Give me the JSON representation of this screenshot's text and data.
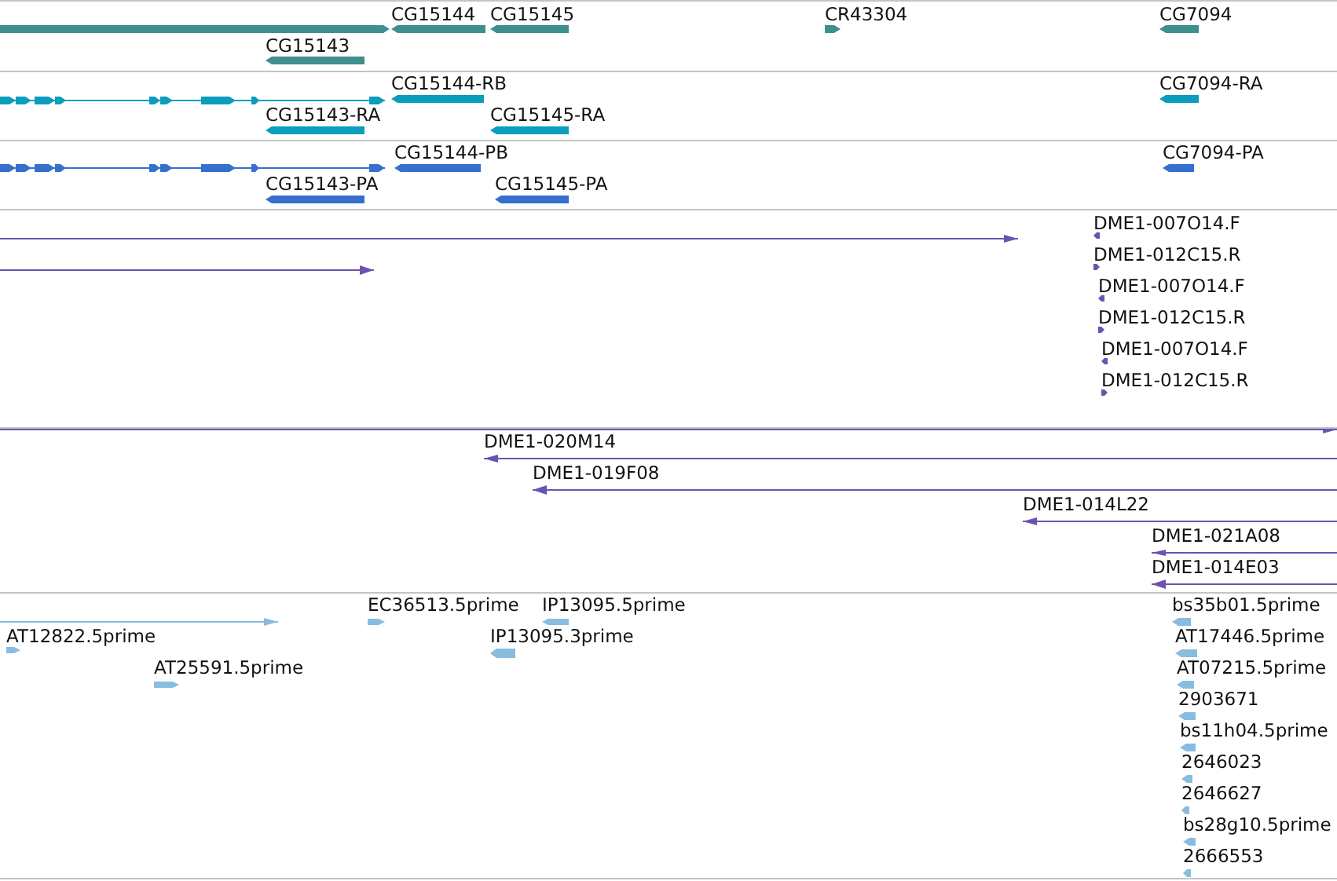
{
  "tracks": [
    {
      "color": "#3f8f8f",
      "features": [
        {
          "kind": "bar",
          "forward": true
        },
        {
          "kind": "bar",
          "forward": false,
          "label": "CG15144"
        },
        {
          "kind": "bar",
          "forward": false,
          "label": "CG15145"
        },
        {
          "kind": "bar",
          "forward": false,
          "label": "CG15143"
        },
        {
          "kind": "bar",
          "forward": true,
          "label": "CR43304"
        },
        {
          "kind": "bar",
          "forward": false,
          "label": "CG7094"
        }
      ]
    },
    {
      "color": "#0a9dbd",
      "features": [
        {
          "kind": "transcript",
          "forward": true
        },
        {
          "kind": "bar",
          "forward": false,
          "label": "CG15144-RB"
        },
        {
          "kind": "bar",
          "forward": false,
          "label": "CG15143-RA"
        },
        {
          "kind": "bar",
          "forward": false,
          "label": "CG15145-RA"
        },
        {
          "kind": "bar",
          "forward": false,
          "label": "CG7094-RA"
        }
      ]
    },
    {
      "color": "#3570cc",
      "features": [
        {
          "kind": "transcript",
          "forward": true
        },
        {
          "kind": "bar",
          "forward": false,
          "label": "CG15144-PB"
        },
        {
          "kind": "bar",
          "forward": false,
          "label": "CG15143-PA"
        },
        {
          "kind": "bar",
          "forward": false,
          "label": "CG15145-PA"
        },
        {
          "kind": "bar",
          "forward": false,
          "label": "CG7094-PA"
        }
      ]
    },
    {
      "color": "#6c52b0",
      "features": [
        {
          "kind": "line",
          "forward": true
        },
        {
          "kind": "line",
          "forward": true
        },
        {
          "kind": "marker",
          "forward": false,
          "label": "DME1-007O14.F"
        },
        {
          "kind": "marker",
          "forward": true,
          "label": "DME1-012C15.R"
        },
        {
          "kind": "marker",
          "forward": false,
          "label": "DME1-007O14.F"
        },
        {
          "kind": "marker",
          "forward": true,
          "label": "DME1-012C15.R"
        },
        {
          "kind": "marker",
          "forward": false,
          "label": "DME1-007O14.F"
        },
        {
          "kind": "marker",
          "forward": true,
          "label": "DME1-012C15.R"
        }
      ]
    },
    {
      "color": "#6c52b0",
      "features": [
        {
          "kind": "line",
          "forward": true
        },
        {
          "kind": "line",
          "forward": false,
          "label": "DME1-020M14"
        },
        {
          "kind": "line",
          "forward": false,
          "label": "DME1-019F08"
        },
        {
          "kind": "line",
          "forward": false,
          "label": "DME1-014L22"
        },
        {
          "kind": "line",
          "forward": false,
          "label": "DME1-021A08"
        },
        {
          "kind": "line",
          "forward": false,
          "label": "DME1-014E03"
        }
      ]
    },
    {
      "color": "#88bde0",
      "features": [
        {
          "kind": "line",
          "forward": true
        },
        {
          "kind": "marker",
          "forward": true,
          "label": "AT12822.5prime"
        },
        {
          "kind": "marker",
          "forward": true,
          "label": "EC36513.5prime"
        },
        {
          "kind": "marker",
          "forward": false,
          "label": "IP13095.5prime"
        },
        {
          "kind": "bar",
          "forward": false,
          "label": "IP13095.3prime"
        },
        {
          "kind": "marker",
          "forward": true,
          "label": "AT25591.5prime"
        },
        {
          "kind": "marker",
          "forward": false,
          "label": "bs35b01.5prime"
        },
        {
          "kind": "marker",
          "forward": false,
          "label": "AT17446.5prime"
        },
        {
          "kind": "marker",
          "forward": false,
          "label": "AT07215.5prime"
        },
        {
          "kind": "marker",
          "forward": false,
          "label": "2903671"
        },
        {
          "kind": "marker",
          "forward": false,
          "label": "bs11h04.5prime"
        },
        {
          "kind": "marker",
          "forward": false,
          "label": "2646023"
        },
        {
          "kind": "marker",
          "forward": false,
          "label": "2646627"
        },
        {
          "kind": "marker",
          "forward": false,
          "label": "bs28g10.5prime"
        },
        {
          "kind": "marker",
          "forward": false,
          "label": "2666553"
        }
      ]
    }
  ]
}
